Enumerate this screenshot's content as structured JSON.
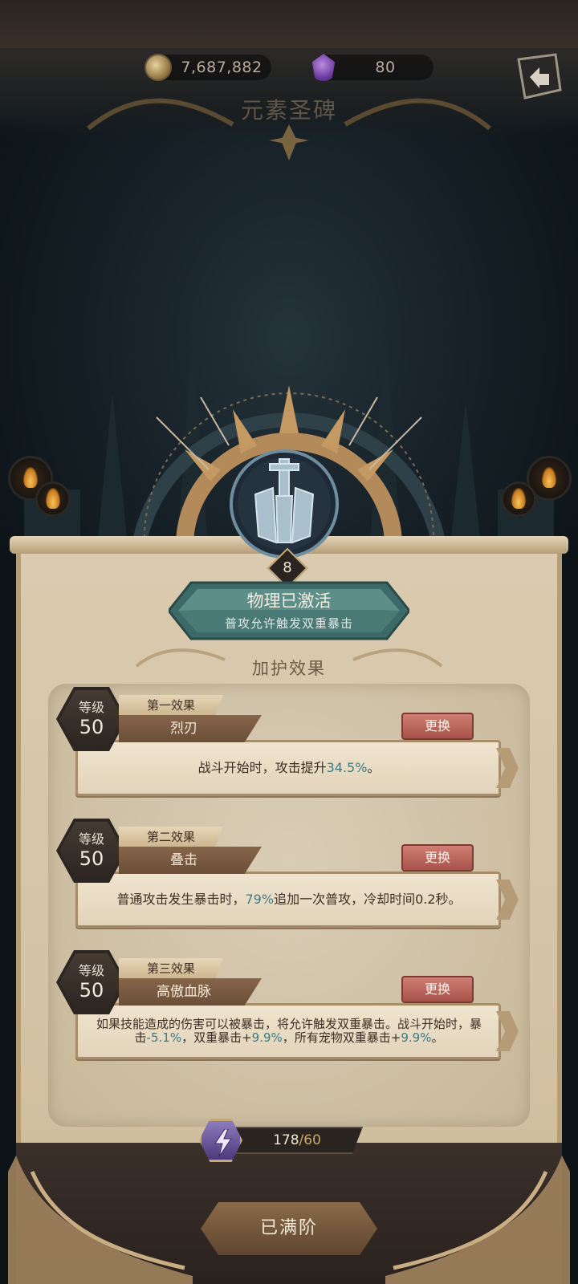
{
  "header": {
    "coins": "7,687,882",
    "gems": "80",
    "title": "元素圣碑"
  },
  "emblem": {
    "level": "8",
    "icon": "sword-shield-icon"
  },
  "activation": {
    "title": "物理已激活",
    "subtitle": "普攻允许触发双重暴击"
  },
  "section_title": "加护效果",
  "effects": [
    {
      "level_label": "等级",
      "level": "50",
      "slot": "第一效果",
      "name": "烈刃",
      "swap_label": "更换",
      "desc_parts": [
        "战斗开始时，攻击提升",
        "34.5%",
        "。"
      ]
    },
    {
      "level_label": "等级",
      "level": "50",
      "slot": "第二效果",
      "name": "叠击",
      "swap_label": "更换",
      "desc_parts": [
        "普通攻击发生暴击时，",
        "79%",
        "追加一次普攻，冷却时间0.2秒。"
      ]
    },
    {
      "level_label": "等级",
      "level": "50",
      "slot": "第三效果",
      "name": "高傲血脉",
      "swap_label": "更换",
      "desc_parts": [
        "如果技能造成的伤害可以被暴击，将允许触发双重暴击。战斗开始时，暴击",
        "-5.1%",
        "，双重暴击+",
        "9.9%",
        "，所有宠物双重暴击+",
        "9.9%",
        "。"
      ]
    }
  ],
  "progress": {
    "current": "178",
    "separator": "/",
    "max": "60"
  },
  "maxed_label": "已满阶",
  "colors": {
    "highlight": "#3a7c8a",
    "swap_button": "#b85a50",
    "panel": "#d4c3a4"
  }
}
